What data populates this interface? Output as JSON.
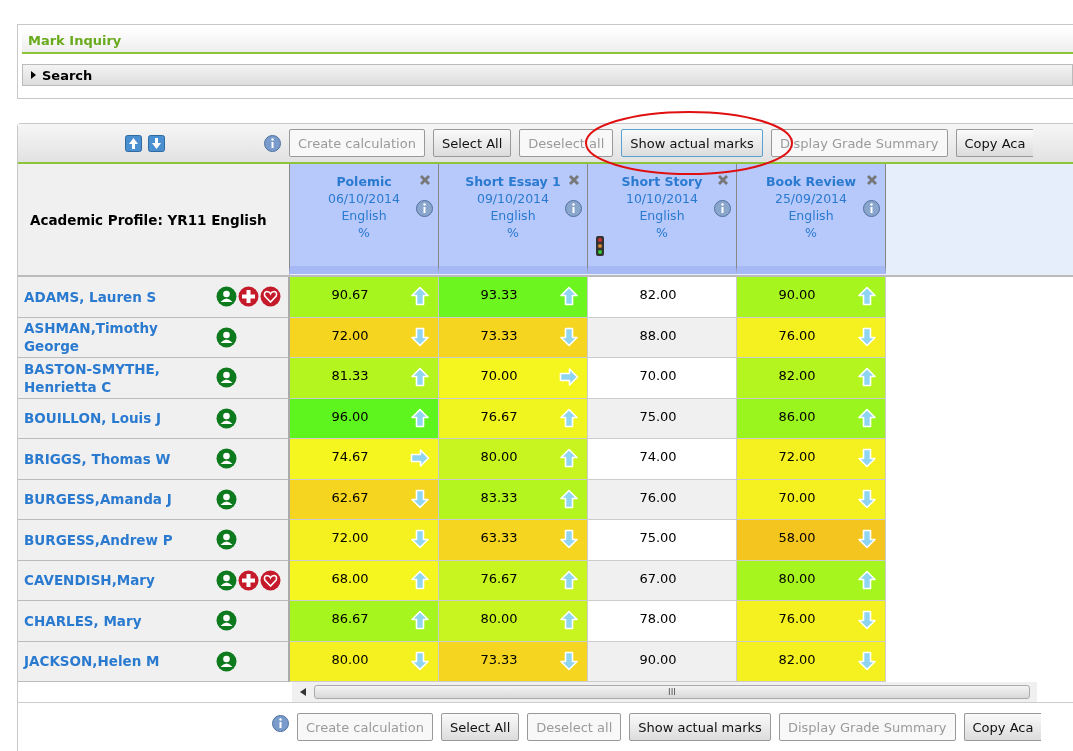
{
  "panel": {
    "title": "Mark Inquiry",
    "search_label": "Search",
    "search_expanded": false
  },
  "toolbar_top": [
    {
      "label": "Create calculation",
      "disabled": true
    },
    {
      "label": "Select All",
      "disabled": false
    },
    {
      "label": "Deselect all",
      "disabled": true
    },
    {
      "label": "Show actual marks",
      "disabled": false,
      "highlighted": true
    },
    {
      "label": "Display Grade Summary",
      "disabled": true
    },
    {
      "label": "Copy Aca",
      "disabled": false
    }
  ],
  "profile_title": "Academic Profile: YR11 English",
  "columns": [
    {
      "name": "Polemic",
      "date": "06/10/2014",
      "subject": "English",
      "unit": "%",
      "traffic_light": false
    },
    {
      "name": "Short Essay 1",
      "date": "09/10/2014",
      "subject": "English",
      "unit": "%",
      "traffic_light": false
    },
    {
      "name": "Short Story",
      "date": "10/10/2014",
      "subject": "English",
      "unit": "%",
      "traffic_light": true
    },
    {
      "name": "Book Review",
      "date": "25/09/2014",
      "subject": "English",
      "unit": "%",
      "traffic_light": false
    }
  ],
  "rows": [
    {
      "student": "ADAMS, Lauren S",
      "icons": [
        {
          "kind": "person"
        },
        {
          "kind": "medical"
        },
        {
          "kind": "heart"
        }
      ],
      "cells": [
        {
          "value": "90.67",
          "color": "#a6f51f",
          "kind": "up"
        },
        {
          "value": "93.33",
          "color": "#6df51f",
          "kind": "up"
        },
        {
          "value": "82.00",
          "color": "#ffffff",
          "kind": "plain"
        },
        {
          "value": "90.00",
          "color": "#a6f51f",
          "kind": "up"
        }
      ]
    },
    {
      "student": "ASHMAN,Timothy George",
      "icons": [
        {
          "kind": "person"
        }
      ],
      "cells": [
        {
          "value": "72.00",
          "color": "#f5d51f",
          "kind": "down"
        },
        {
          "value": "73.33",
          "color": "#f5d51f",
          "kind": "down"
        },
        {
          "value": "88.00",
          "color": "#f0f0f0",
          "kind": "plain"
        },
        {
          "value": "76.00",
          "color": "#f5f01f",
          "kind": "down"
        }
      ]
    },
    {
      "student": "BASTON-SMYTHE, Henrietta C",
      "icons": [
        {
          "kind": "person"
        }
      ],
      "cells": [
        {
          "value": "81.33",
          "color": "#b5f51f",
          "kind": "up"
        },
        {
          "value": "70.00",
          "color": "#f5f51f",
          "kind": "right"
        },
        {
          "value": "70.00",
          "color": "#ffffff",
          "kind": "plain"
        },
        {
          "value": "82.00",
          "color": "#b5f51f",
          "kind": "up"
        }
      ]
    },
    {
      "student": "BOUILLON, Louis J",
      "icons": [
        {
          "kind": "person"
        }
      ],
      "cells": [
        {
          "value": "96.00",
          "color": "#5ef51f",
          "kind": "up"
        },
        {
          "value": "76.67",
          "color": "#f0f51f",
          "kind": "up"
        },
        {
          "value": "75.00",
          "color": "#f0f0f0",
          "kind": "plain"
        },
        {
          "value": "86.00",
          "color": "#9af51f",
          "kind": "up"
        }
      ]
    },
    {
      "student": "BRIGGS, Thomas W",
      "icons": [
        {
          "kind": "person"
        }
      ],
      "cells": [
        {
          "value": "74.67",
          "color": "#f5f51f",
          "kind": "right"
        },
        {
          "value": "80.00",
          "color": "#c8f51f",
          "kind": "up"
        },
        {
          "value": "74.00",
          "color": "#ffffff",
          "kind": "plain"
        },
        {
          "value": "72.00",
          "color": "#f5f01f",
          "kind": "down"
        }
      ]
    },
    {
      "student": "BURGESS,Amanda J",
      "icons": [
        {
          "kind": "person"
        }
      ],
      "cells": [
        {
          "value": "62.67",
          "color": "#f5d51f",
          "kind": "down"
        },
        {
          "value": "83.33",
          "color": "#b5f51f",
          "kind": "up"
        },
        {
          "value": "76.00",
          "color": "#f0f0f0",
          "kind": "plain"
        },
        {
          "value": "70.00",
          "color": "#f5f01f",
          "kind": "down"
        }
      ]
    },
    {
      "student": "BURGESS,Andrew P",
      "icons": [
        {
          "kind": "person"
        }
      ],
      "cells": [
        {
          "value": "72.00",
          "color": "#f5f01f",
          "kind": "down"
        },
        {
          "value": "63.33",
          "color": "#f5d51f",
          "kind": "down"
        },
        {
          "value": "75.00",
          "color": "#ffffff",
          "kind": "plain"
        },
        {
          "value": "58.00",
          "color": "#f5c51f",
          "kind": "down"
        }
      ]
    },
    {
      "student": "CAVENDISH,Mary",
      "icons": [
        {
          "kind": "person"
        },
        {
          "kind": "medical"
        },
        {
          "kind": "heart"
        }
      ],
      "cells": [
        {
          "value": "68.00",
          "color": "#f5f51f",
          "kind": "up"
        },
        {
          "value": "76.67",
          "color": "#c8f51f",
          "kind": "up"
        },
        {
          "value": "67.00",
          "color": "#f0f0f0",
          "kind": "plain"
        },
        {
          "value": "80.00",
          "color": "#a6f51f",
          "kind": "up"
        }
      ]
    },
    {
      "student": "CHARLES, Mary",
      "icons": [
        {
          "kind": "person"
        }
      ],
      "cells": [
        {
          "value": "86.67",
          "color": "#a6f51f",
          "kind": "up"
        },
        {
          "value": "80.00",
          "color": "#c8f51f",
          "kind": "up"
        },
        {
          "value": "78.00",
          "color": "#ffffff",
          "kind": "plain"
        },
        {
          "value": "76.00",
          "color": "#f5f01f",
          "kind": "down"
        }
      ]
    },
    {
      "student": "JACKSON,Helen M",
      "icons": [
        {
          "kind": "person"
        }
      ],
      "cells": [
        {
          "value": "80.00",
          "color": "#f5f01f",
          "kind": "down"
        },
        {
          "value": "73.33",
          "color": "#f5d51f",
          "kind": "down"
        },
        {
          "value": "90.00",
          "color": "#f0f0f0",
          "kind": "plain"
        },
        {
          "value": "82.00",
          "color": "#f5f01f",
          "kind": "down"
        }
      ]
    }
  ],
  "scrollbar_grip": "III",
  "toolbar_bottom": [
    {
      "label": "Create calculation",
      "disabled": true
    },
    {
      "label": "Select All",
      "disabled": false
    },
    {
      "label": "Deselect all",
      "disabled": true
    },
    {
      "label": "Show actual marks",
      "disabled": false,
      "highlighted": false
    },
    {
      "label": "Display Grade Summary",
      "disabled": true
    },
    {
      "label": "Copy Aca",
      "disabled": false
    }
  ]
}
